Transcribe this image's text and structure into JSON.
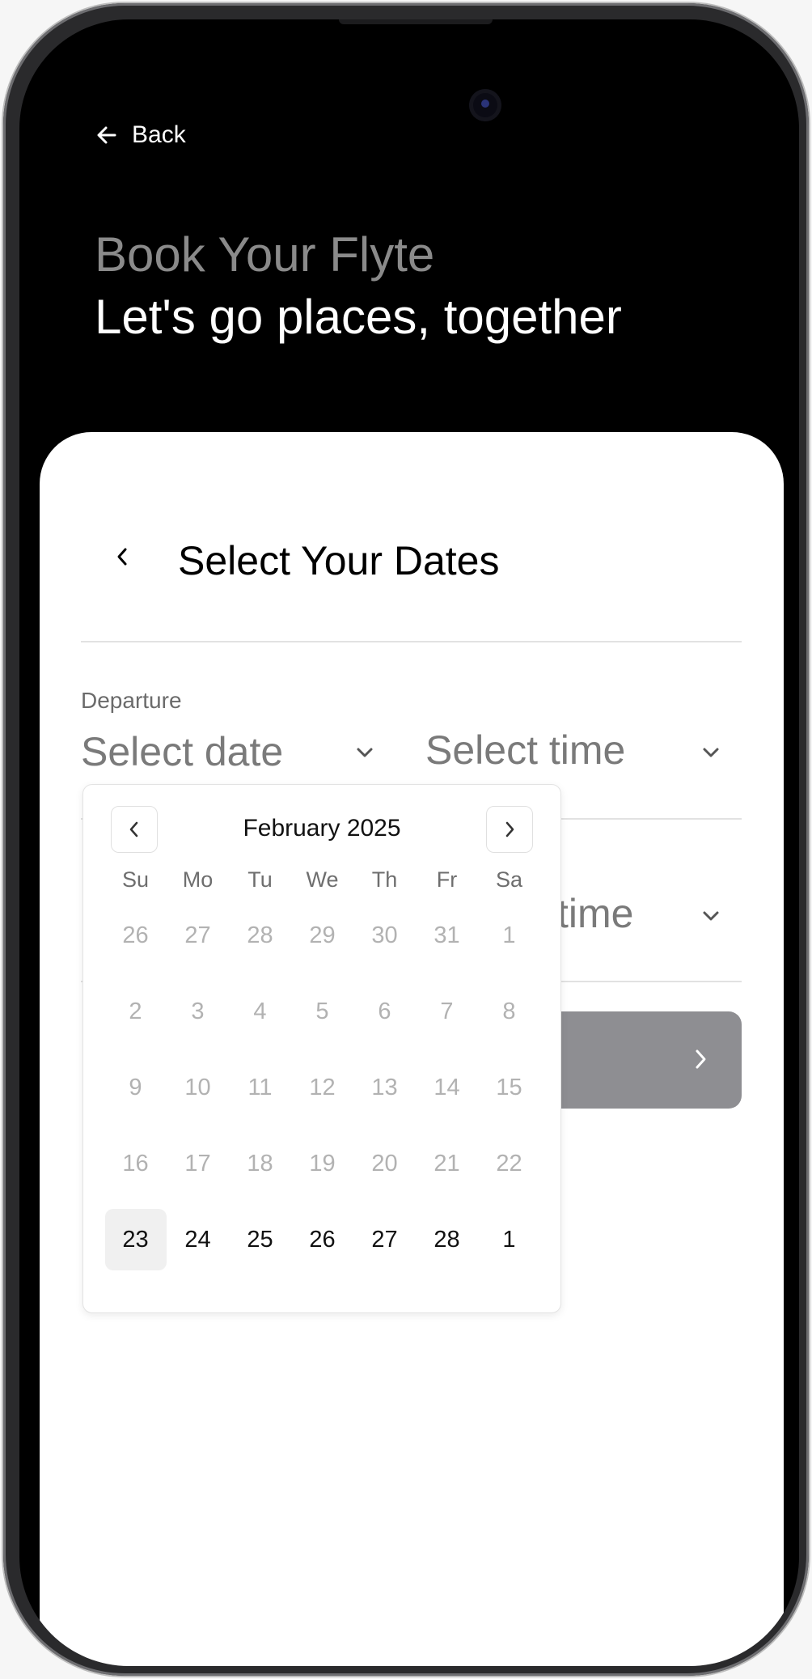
{
  "header": {
    "back_label": "Back",
    "title": "Book Your Flyte",
    "subtitle": "Let's go places, together"
  },
  "card": {
    "title": "Select Your Dates",
    "departure": {
      "label": "Departure",
      "date_placeholder": "Select date",
      "time_placeholder": "Select time"
    },
    "return": {
      "time_placeholder_visible": "time"
    }
  },
  "calendar": {
    "month_label": "February 2025",
    "weekdays": [
      "Su",
      "Mo",
      "Tu",
      "We",
      "Th",
      "Fr",
      "Sa"
    ],
    "weeks": [
      [
        {
          "d": "26",
          "active": false
        },
        {
          "d": "27",
          "active": false
        },
        {
          "d": "28",
          "active": false
        },
        {
          "d": "29",
          "active": false
        },
        {
          "d": "30",
          "active": false
        },
        {
          "d": "31",
          "active": false
        },
        {
          "d": "1",
          "active": false
        }
      ],
      [
        {
          "d": "2",
          "active": false
        },
        {
          "d": "3",
          "active": false
        },
        {
          "d": "4",
          "active": false
        },
        {
          "d": "5",
          "active": false
        },
        {
          "d": "6",
          "active": false
        },
        {
          "d": "7",
          "active": false
        },
        {
          "d": "8",
          "active": false
        }
      ],
      [
        {
          "d": "9",
          "active": false
        },
        {
          "d": "10",
          "active": false
        },
        {
          "d": "11",
          "active": false
        },
        {
          "d": "12",
          "active": false
        },
        {
          "d": "13",
          "active": false
        },
        {
          "d": "14",
          "active": false
        },
        {
          "d": "15",
          "active": false
        }
      ],
      [
        {
          "d": "16",
          "active": false
        },
        {
          "d": "17",
          "active": false
        },
        {
          "d": "18",
          "active": false
        },
        {
          "d": "19",
          "active": false
        },
        {
          "d": "20",
          "active": false
        },
        {
          "d": "21",
          "active": false
        },
        {
          "d": "22",
          "active": false
        }
      ],
      [
        {
          "d": "23",
          "active": true,
          "today": true
        },
        {
          "d": "24",
          "active": true
        },
        {
          "d": "25",
          "active": true
        },
        {
          "d": "26",
          "active": true
        },
        {
          "d": "27",
          "active": true
        },
        {
          "d": "28",
          "active": true
        },
        {
          "d": "1",
          "active": true
        }
      ]
    ]
  },
  "colors": {
    "background": "#000000",
    "card": "#ffffff",
    "continue_button": "#8e8e92",
    "today_highlight": "#f0f0f0"
  },
  "icons": [
    "arrow-left-icon",
    "chevron-left-icon",
    "chevron-down-icon",
    "chevron-right-icon"
  ]
}
